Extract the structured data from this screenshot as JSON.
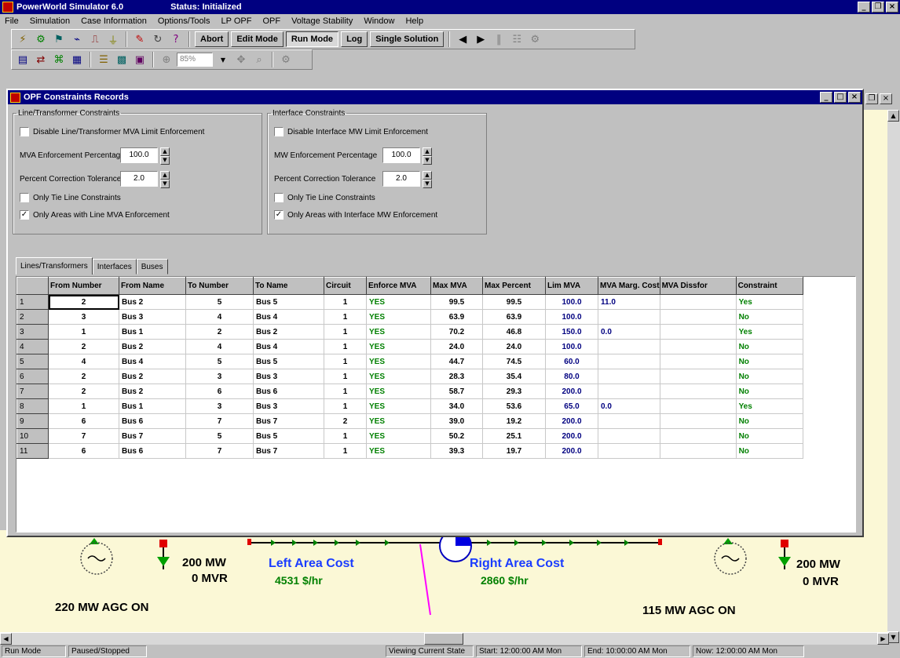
{
  "app": {
    "title": "PowerWorld Simulator 6.0",
    "status": "Status: Initialized"
  },
  "menu": [
    "File",
    "Simulation",
    "Case Information",
    "Options/Tools",
    "LP OPF",
    "OPF",
    "Voltage Stability",
    "Window",
    "Help"
  ],
  "toolbar": {
    "abort": "Abort",
    "edit_mode": "Edit Mode",
    "run_mode": "Run Mode",
    "log": "Log",
    "single_solution": "Single Solution",
    "zoom": "85%"
  },
  "dialog": {
    "title": "OPF Constraints Records",
    "line_group": {
      "legend": "Line/Transformer Constraints",
      "disable_label": "Disable Line/Transformer MVA Limit Enforcement",
      "disable_checked": false,
      "mva_pct_label": "MVA Enforcement Percentage",
      "mva_pct_value": "100.0",
      "tolerance_label": "Percent Correction Tolerance",
      "tolerance_value": "2.0",
      "only_tie_label": "Only Tie Line Constraints",
      "only_tie_checked": false,
      "only_areas_label": "Only Areas with Line MVA Enforcement",
      "only_areas_checked": true
    },
    "interface_group": {
      "legend": "Interface Constraints",
      "disable_label": "Disable Interface MW Limit Enforcement",
      "disable_checked": false,
      "mw_pct_label": "MW Enforcement Percentage",
      "mw_pct_value": "100.0",
      "tolerance_label": "Percent Correction Tolerance",
      "tolerance_value": "2.0",
      "only_tie_label": "Only Tie Line Constraints",
      "only_tie_checked": false,
      "only_areas_label": "Only Areas with Interface MW Enforcement",
      "only_areas_checked": true
    },
    "tabs": [
      "Lines/Transformers",
      "Interfaces",
      "Buses"
    ],
    "active_tab": 0,
    "columns": [
      "From Number",
      "From Name",
      "To Number",
      "To Name",
      "Circuit",
      "Enforce MVA",
      "Max MVA",
      "Max Percent",
      "Lim MVA",
      "MVA Marg. Cost",
      "MVA Dissfor",
      "Constraint"
    ],
    "rows": [
      [
        "1",
        "2",
        "Bus 2",
        "5",
        "Bus 5",
        "1",
        "YES",
        "99.5",
        "99.5",
        "100.0",
        "11.0",
        "Yes"
      ],
      [
        "2",
        "3",
        "Bus 3",
        "4",
        "Bus 4",
        "1",
        "YES",
        "63.9",
        "63.9",
        "100.0",
        "",
        "No"
      ],
      [
        "3",
        "1",
        "Bus 1",
        "2",
        "Bus 2",
        "1",
        "YES",
        "70.2",
        "46.8",
        "150.0",
        "0.0",
        "Yes"
      ],
      [
        "4",
        "2",
        "Bus 2",
        "4",
        "Bus 4",
        "1",
        "YES",
        "24.0",
        "24.0",
        "100.0",
        "",
        "No"
      ],
      [
        "5",
        "4",
        "Bus 4",
        "5",
        "Bus 5",
        "1",
        "YES",
        "44.7",
        "74.5",
        "60.0",
        "",
        "No"
      ],
      [
        "6",
        "2",
        "Bus 2",
        "3",
        "Bus 3",
        "1",
        "YES",
        "28.3",
        "35.4",
        "80.0",
        "",
        "No"
      ],
      [
        "7",
        "2",
        "Bus 2",
        "6",
        "Bus 6",
        "1",
        "YES",
        "58.7",
        "29.3",
        "200.0",
        "",
        "No"
      ],
      [
        "8",
        "1",
        "Bus 1",
        "3",
        "Bus 3",
        "1",
        "YES",
        "34.0",
        "53.6",
        "65.0",
        "0.0",
        "Yes"
      ],
      [
        "9",
        "6",
        "Bus 6",
        "7",
        "Bus 7",
        "2",
        "YES",
        "39.0",
        "19.2",
        "200.0",
        "",
        "No"
      ],
      [
        "10",
        "7",
        "Bus 7",
        "5",
        "Bus 5",
        "1",
        "YES",
        "50.2",
        "25.1",
        "200.0",
        "",
        "No"
      ],
      [
        "11",
        "6",
        "Bus 6",
        "7",
        "Bus 7",
        "1",
        "YES",
        "39.3",
        "19.7",
        "200.0",
        "",
        "No"
      ]
    ]
  },
  "oneline": {
    "left_gen_mw": "200 MW",
    "left_gen_mvr": "0 MVR",
    "left_agc": "220 MW AGC ON",
    "left_area_title": "Left Area Cost",
    "left_area_value": "4531 $/hr",
    "right_area_title": "Right Area Cost",
    "right_area_value": "2860 $/hr",
    "right_gen_mw": "200 MW",
    "right_gen_mvr": "0 MVR",
    "right_agc": "115 MW AGC ON"
  },
  "statusbar": [
    "Run Mode",
    "Paused/Stopped",
    "Viewing Current State",
    "Start: 12:00:00 AM Mon",
    "End: 10:00:00 AM Mon",
    "Now: 12:00:00 AM Mon"
  ]
}
